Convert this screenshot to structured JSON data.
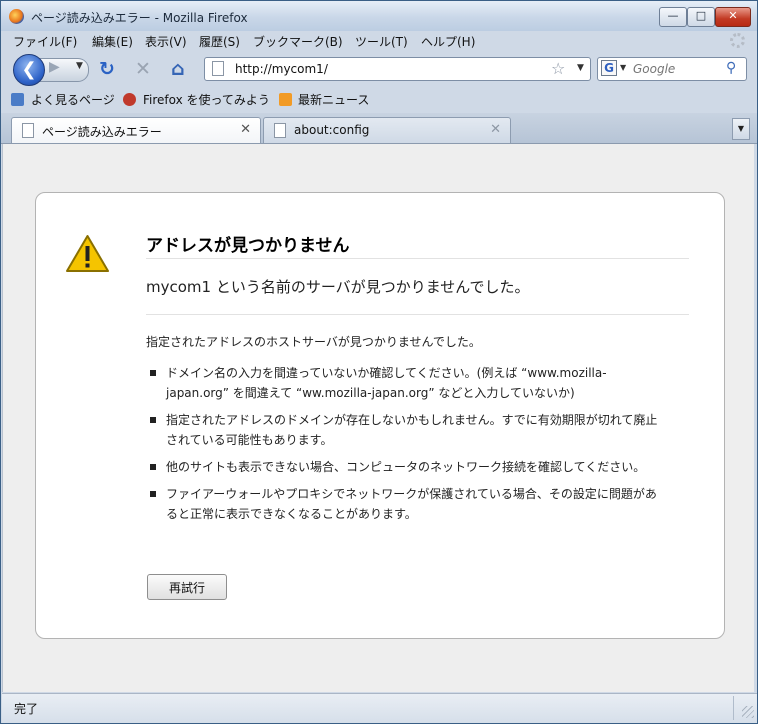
{
  "window": {
    "title": "ページ読み込みエラー - Mozilla Firefox"
  },
  "menubar": {
    "items": [
      "ファイル(F)",
      "編集(E)",
      "表示(V)",
      "履歴(S)",
      "ブックマーク(B)",
      "ツール(T)",
      "ヘルプ(H)"
    ]
  },
  "navbar": {
    "url": "http://mycom1/",
    "search_placeholder": "Google"
  },
  "bookmarks": {
    "items": [
      "よく見るページ",
      "Firefox を使ってみよう",
      "最新ニュース"
    ]
  },
  "tabs": [
    {
      "label": "ページ読み込みエラー",
      "active": true
    },
    {
      "label": "about:config",
      "active": false
    }
  ],
  "error_page": {
    "title": "アドレスが見つかりません",
    "subtitle": "mycom1 という名前のサーバが見つかりませんでした。",
    "lead": "指定されたアドレスのホストサーバが見つかりませんでした。",
    "bullets": [
      "ドメイン名の入力を間違っていないか確認してください。(例えば “www.mozilla-japan.org” を間違えて “ww.mozilla-japan.org” などと入力していないか)",
      "指定されたアドレスのドメインが存在しないかもしれません。すでに有効期限が切れて廃止されている可能性もあります。",
      "他のサイトも表示できない場合、コンピュータのネットワーク接続を確認してください。",
      "ファイアーウォールやプロキシでネットワークが保護されている場合、その設定に問題があると正常に表示できなくなることがあります。"
    ],
    "retry_label": "再試行"
  },
  "statusbar": {
    "text": "完了"
  },
  "colors": {
    "accent_blue": "#2d62c8",
    "warning_yellow": "#f5c400",
    "close_red": "#c23a23"
  }
}
